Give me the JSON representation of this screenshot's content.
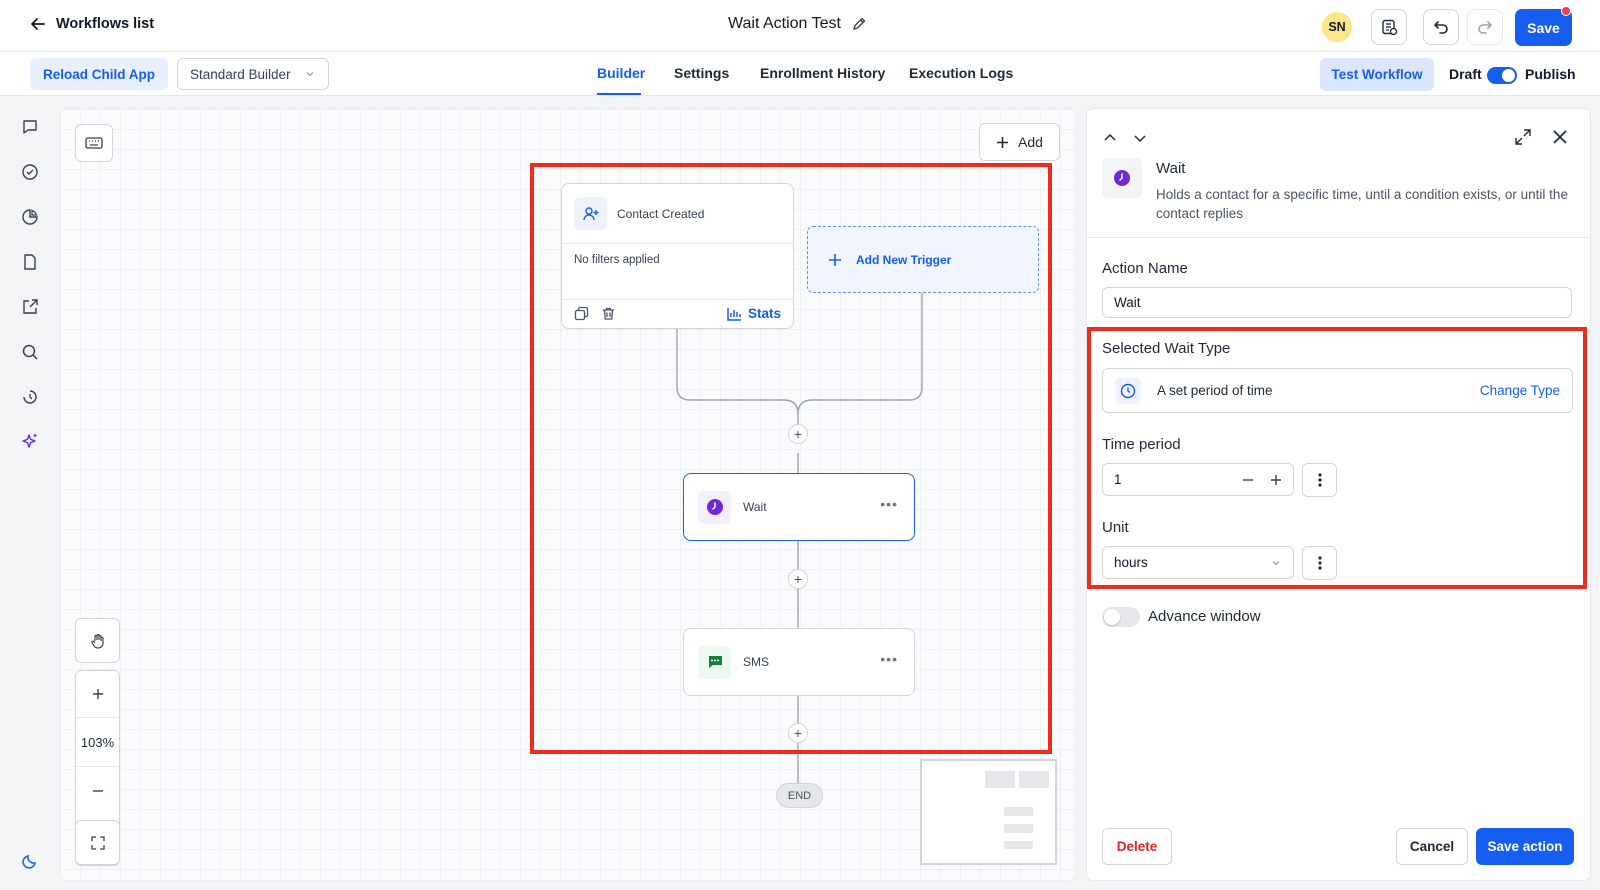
{
  "topbar": {
    "back_label": "Workflows list",
    "workflow_title": "Wait Action Test",
    "avatar_initials": "SN",
    "save_label": "Save"
  },
  "subbar": {
    "reload_label": "Reload Child App",
    "builder_select_value": "Standard Builder",
    "tabs": [
      "Builder",
      "Settings",
      "Enrollment History",
      "Execution Logs"
    ],
    "active_tab": "Builder",
    "test_workflow_label": "Test Workflow",
    "draft_label": "Draft",
    "publish_label": "Publish",
    "publish_toggle_on": true
  },
  "rail": {
    "icons": [
      "chat-icon",
      "check-circle-icon",
      "pie-chart-icon",
      "document-icon",
      "external-link-icon",
      "search-icon",
      "history-icon",
      "sparkle-icon"
    ],
    "theme_icon": "moon-icon"
  },
  "canvas": {
    "add_label": "Add",
    "trigger": {
      "name": "Contact Created",
      "filters": "No filters applied",
      "stats_label": "Stats"
    },
    "new_trigger_label": "Add New Trigger",
    "nodes": [
      {
        "name": "Wait",
        "icon": "clock-icon",
        "selected": true
      },
      {
        "name": "SMS",
        "icon": "message-icon",
        "selected": false
      }
    ],
    "end_label": "END",
    "zoom_level": "103%"
  },
  "panel": {
    "action_title": "Wait",
    "action_description": "Holds a contact for a specific time, until a condition exists, or until the contact replies",
    "action_name_label": "Action Name",
    "action_name_value": "Wait",
    "wait_type_label": "Selected Wait Type",
    "wait_type_value": "A set period of time",
    "change_type_label": "Change Type",
    "time_period_label": "Time period",
    "time_period_value": "1",
    "unit_label": "Unit",
    "unit_value": "hours",
    "advance_window_label": "Advance window",
    "advance_window_on": false,
    "delete_label": "Delete",
    "cancel_label": "Cancel",
    "save_action_label": "Save action"
  },
  "colors": {
    "accent": "#155eef",
    "highlight_red": "#ef2b1e",
    "wait_purple": "#6d28d9",
    "sms_green": "#15803d",
    "delete_red": "#dc2626"
  }
}
